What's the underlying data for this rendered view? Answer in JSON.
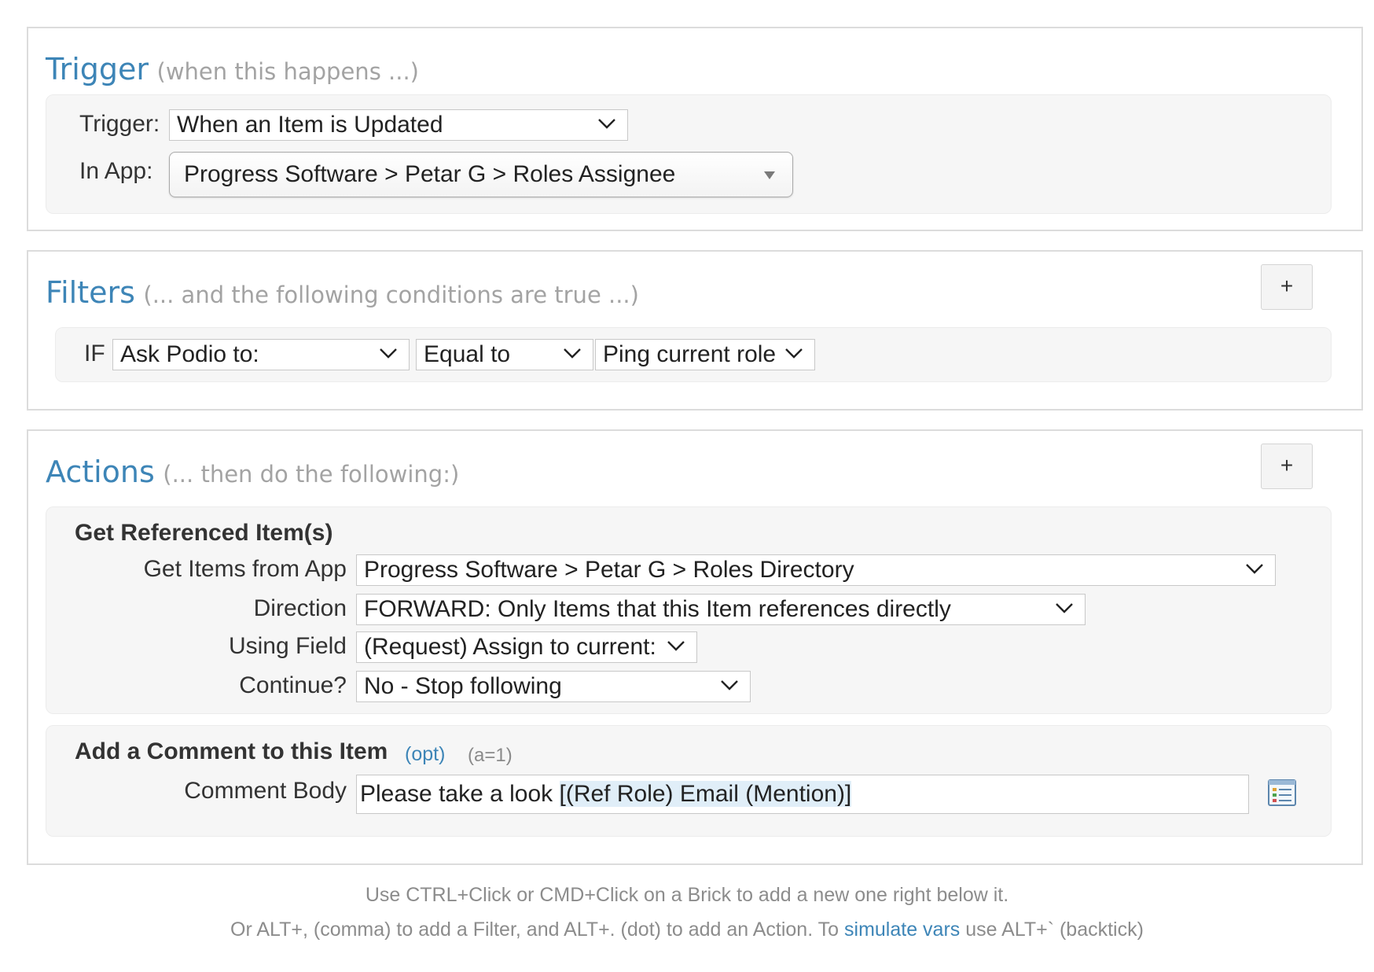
{
  "trigger_panel": {
    "title": "Trigger",
    "subtitle": "(when this happens ...)",
    "trigger_label": "Trigger:",
    "trigger_value": "When an Item is Updated",
    "app_label": "In App:",
    "app_value": "Progress Software > Petar G > Roles Assignee"
  },
  "filters_panel": {
    "title": "Filters",
    "subtitle": "(... and the following conditions are true ...)",
    "add_label": "+",
    "if_label": "IF",
    "field_value": "Ask Podio to:",
    "operator_value": "Equal to",
    "compare_value": "Ping current role"
  },
  "actions_panel": {
    "title": "Actions",
    "subtitle": "(... then do the following:)",
    "add_label": "+",
    "get_ref": {
      "heading": "Get Referenced Item(s)",
      "app_label": "Get Items from App",
      "app_value": "Progress Software > Petar G > Roles Directory",
      "direction_label": "Direction",
      "direction_value": "FORWARD: Only Items that this Item references directly",
      "field_label": "Using Field",
      "field_value": "(Request) Assign to current:",
      "continue_label": "Continue?",
      "continue_value": "No - Stop following"
    },
    "comment": {
      "heading": "Add a Comment to this Item",
      "opt_label": "(opt)",
      "a_note": "(a=1)",
      "body_label": "Comment Body",
      "body_text": "Please take a look ",
      "body_token": "[(Ref Role) Email (Mention)]",
      "vars_icon": "variables-list-icon"
    }
  },
  "footer": {
    "line1": "Use CTRL+Click or CMD+Click on a Brick to add a new one right below it.",
    "line2_before": "Or ALT+, (comma) to add a Filter, and ALT+. (dot) to add an Action. To ",
    "line2_link": "simulate vars",
    "line2_after": " use ALT+` (backtick)"
  },
  "colors": {
    "title_blue": "#3d85b7",
    "subtitle_gray": "#a3a3a3",
    "token_highlight": "#e0eef8"
  }
}
